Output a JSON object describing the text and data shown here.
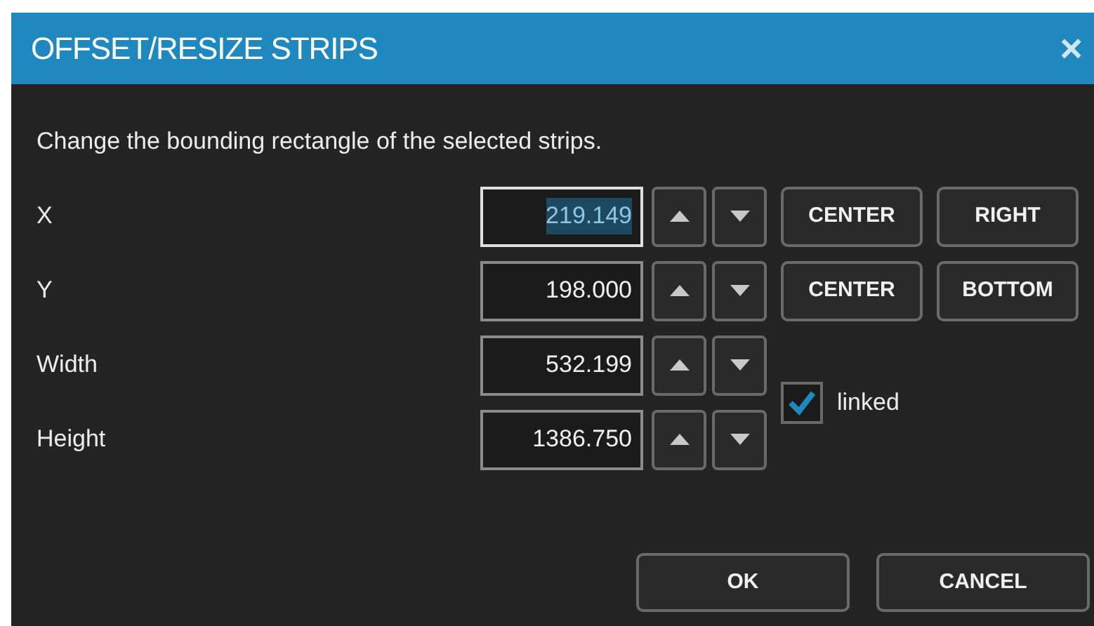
{
  "window": {
    "title": "OFFSET/RESIZE STRIPS",
    "close": "×"
  },
  "description": "Change the bounding rectangle of the selected strips.",
  "fields": [
    {
      "label": "X",
      "value": "219.149",
      "focused": true,
      "buttons": [
        "CENTER",
        "RIGHT"
      ]
    },
    {
      "label": "Y",
      "value": "198.000",
      "focused": false,
      "buttons": [
        "CENTER",
        "BOTTOM"
      ]
    },
    {
      "label": "Width",
      "value": "532.199",
      "focused": false
    },
    {
      "label": "Height",
      "value": "1386.750",
      "focused": false
    }
  ],
  "linked": {
    "label": "linked",
    "checked": true
  },
  "buttons": [
    "OK",
    "CANCEL"
  ]
}
